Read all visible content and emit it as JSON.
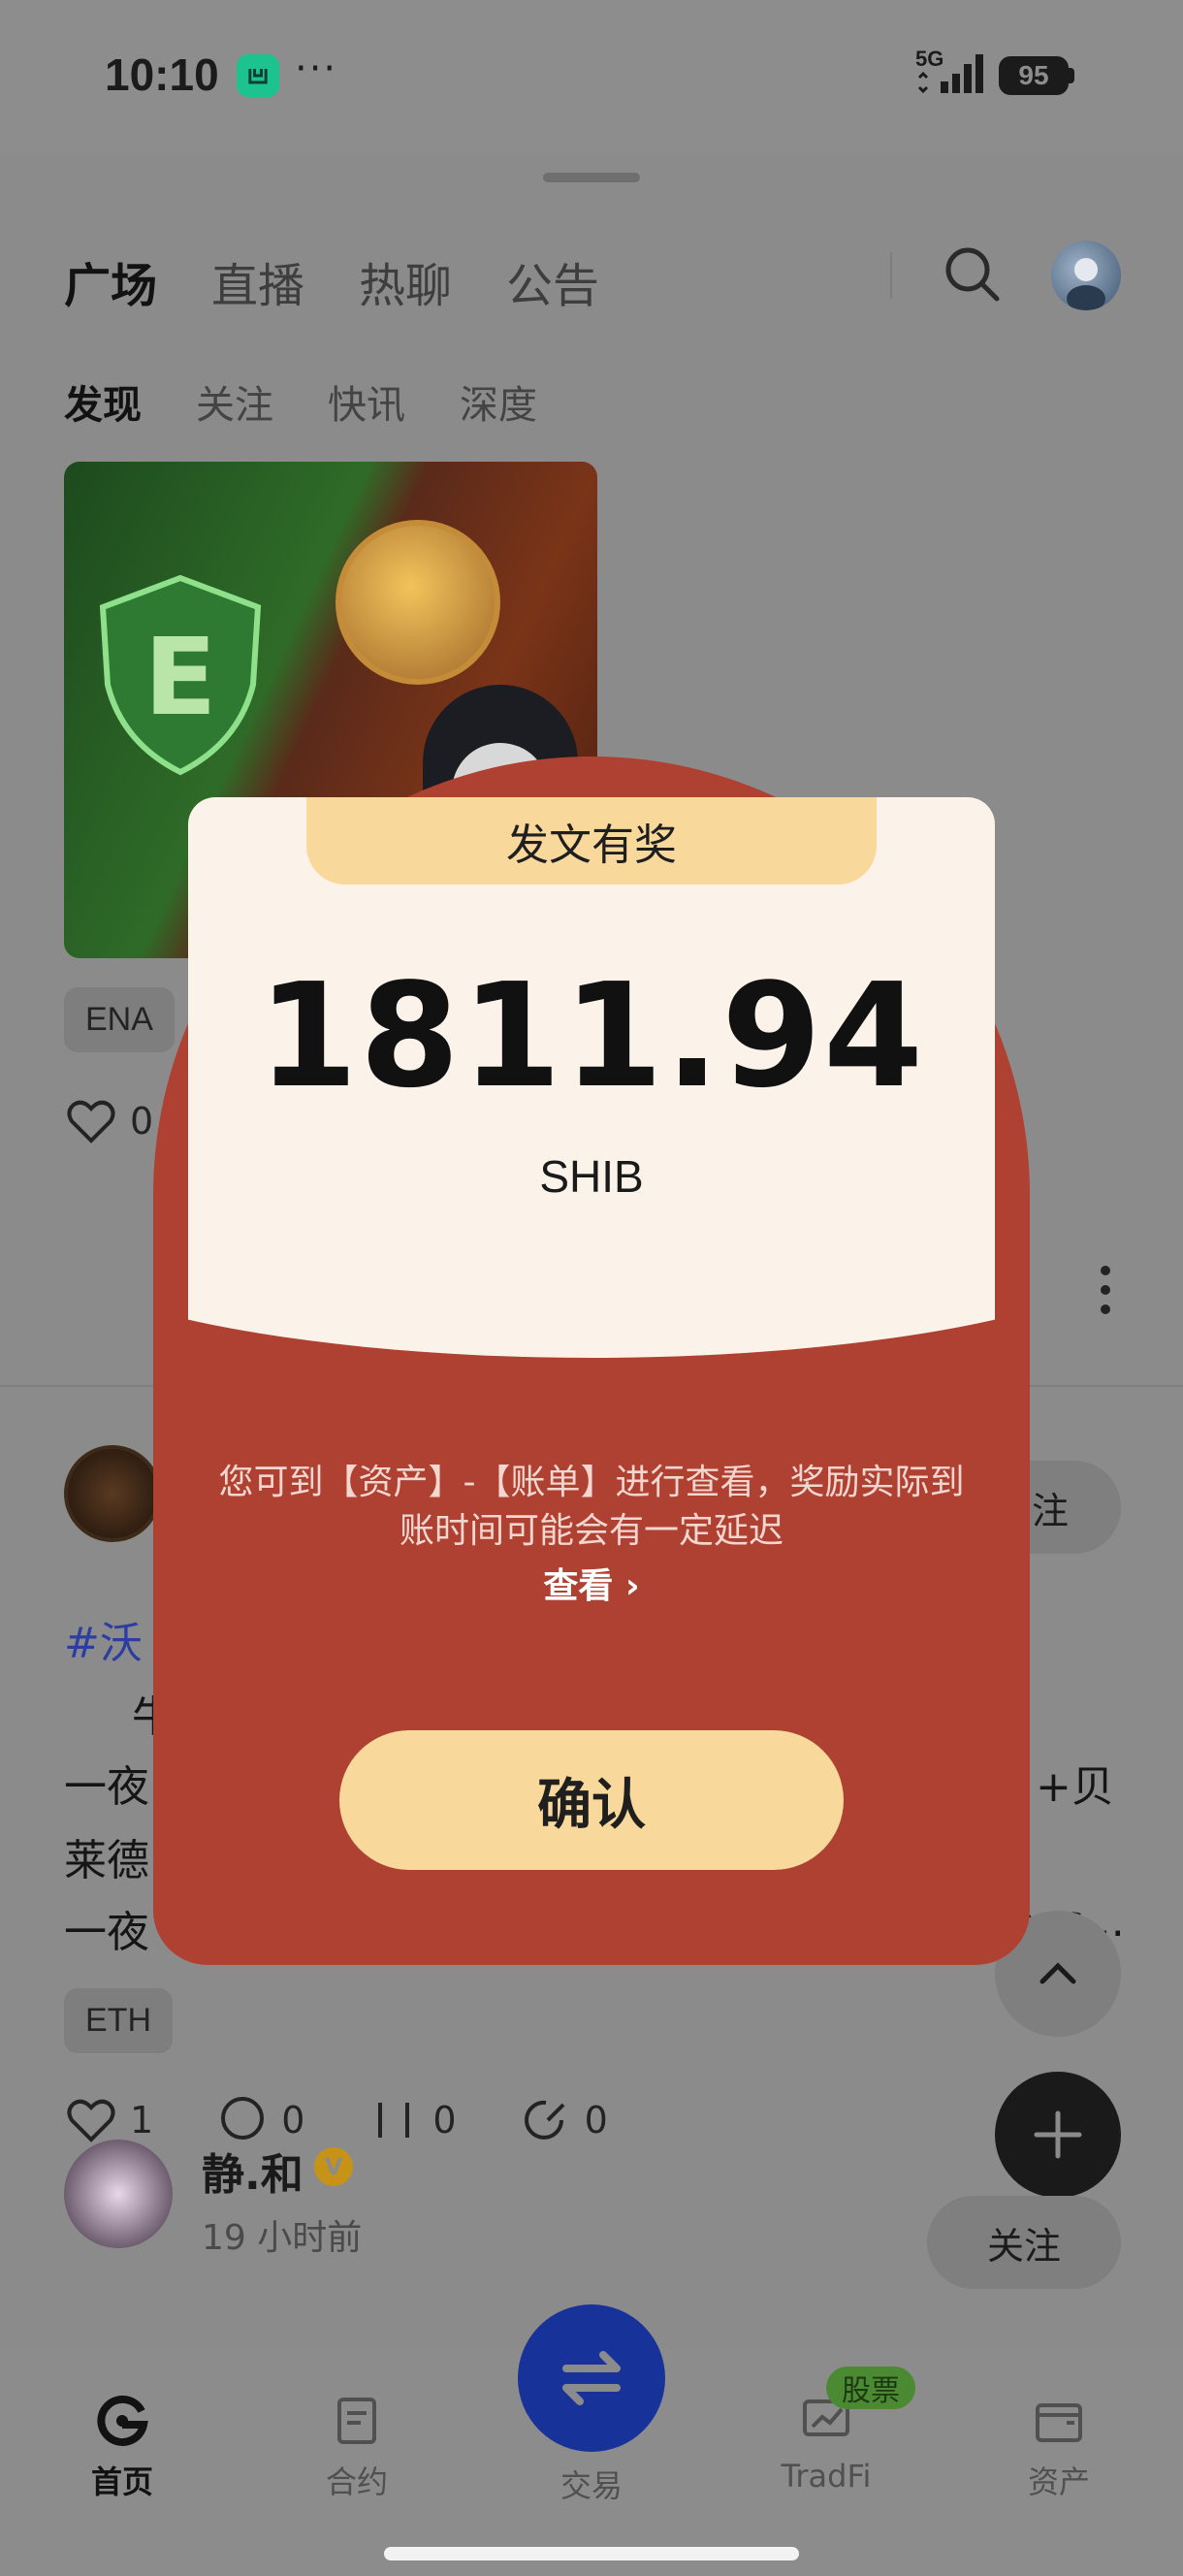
{
  "status_bar": {
    "time": "10:10",
    "more": "···",
    "network": "5G",
    "battery": "95"
  },
  "top_tabs": [
    "广场",
    "直播",
    "热聊",
    "公告"
  ],
  "sub_tabs": [
    "发现",
    "关注",
    "快讯",
    "深度"
  ],
  "post1": {
    "tag": "ENA",
    "likes": "0"
  },
  "post2": {
    "hashtag": "#沃",
    "line1": "牛",
    "line2_start": "一夜",
    "line2_end": "+贝",
    "line3_start": "莱德",
    "line4_start": "一夜",
    "line4_end": "bas...",
    "follow_partial": "注",
    "tag": "ETH",
    "likes": "1",
    "comments": "0",
    "reposts": "0",
    "shares": "0"
  },
  "post3": {
    "author": "静.和",
    "verified": "V",
    "time": "19 小时前",
    "follow": "关注"
  },
  "bottom_nav": {
    "home": "首页",
    "contract": "合约",
    "trade": "交易",
    "tradfi": "TradFi",
    "assets": "资产",
    "stock_badge": "股票"
  },
  "modal": {
    "title": "发文有奖",
    "amount": "1811.94",
    "unit": "SHIB",
    "desc_line1": "您可到【资产】-【账单】进行查看，奖励实际到",
    "desc_line2": "账时间可能会有一定延迟",
    "view_link": "查看 ›",
    "confirm": "确认"
  },
  "colors": {
    "modal_red": "#ae4131",
    "modal_cream": "#fbf3ea",
    "modal_gold": "#f9d89c",
    "trade_blue": "#17339a"
  }
}
